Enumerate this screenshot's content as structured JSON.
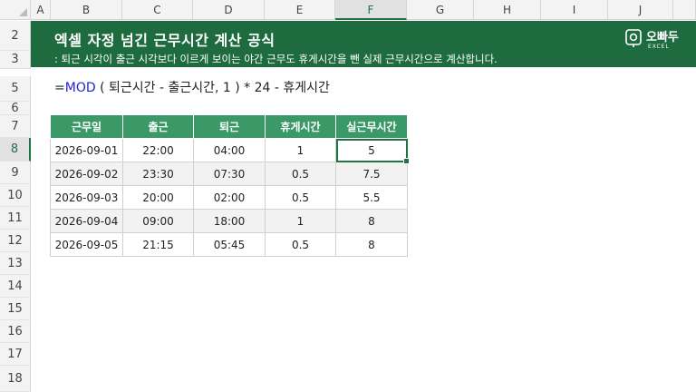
{
  "columns": [
    "A",
    "B",
    "C",
    "D",
    "E",
    "F",
    "G",
    "H",
    "I",
    "J"
  ],
  "selected_column": "F",
  "rows": [
    "2",
    "3",
    "5",
    "6",
    "7",
    "8",
    "9",
    "10",
    "11",
    "12",
    "13",
    "14",
    "15",
    "16",
    "17",
    "18"
  ],
  "selected_row": "8",
  "banner": {
    "title": "엑셀 자정 넘긴 근무시간 계산 공식",
    "subtitle": ": 퇴근 시각이 출근 시각보다 이르게 보이는 야간 근무도 휴게시간을 뺀 실제 근무시간으로 계산합니다.",
    "logo_text": "오빠두",
    "logo_sub": "EXCEL",
    "color": "#1e6b3f"
  },
  "formula": {
    "prefix": "=",
    "function": "MOD",
    "rest": " ( 퇴근시간 - 출근시간, 1 ) * 24 - 휴게시간"
  },
  "table": {
    "headers": [
      "근무일",
      "출근",
      "퇴근",
      "휴게시간",
      "실근무시간"
    ],
    "rows": [
      [
        "2026-09-01",
        "22:00",
        "04:00",
        "1",
        "5"
      ],
      [
        "2026-09-02",
        "23:30",
        "07:30",
        "0.5",
        "7.5"
      ],
      [
        "2026-09-03",
        "20:00",
        "02:00",
        "0.5",
        "5.5"
      ],
      [
        "2026-09-04",
        "09:00",
        "18:00",
        "1",
        "8"
      ],
      [
        "2026-09-05",
        "21:15",
        "05:45",
        "0.5",
        "8"
      ]
    ],
    "header_color": "#3a9967"
  }
}
